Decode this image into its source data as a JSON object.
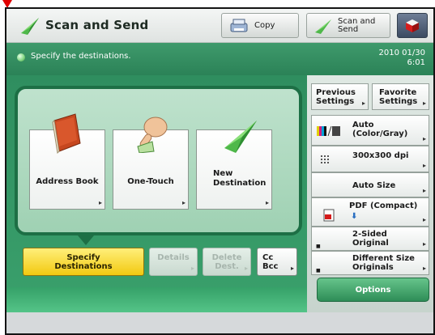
{
  "header": {
    "title": "Scan and Send",
    "copy_label": "Copy",
    "scan_send_label_1": "Scan and",
    "scan_send_label_2": "Send"
  },
  "status": {
    "message": "Specify the destinations.",
    "date": "2010 01/30",
    "time": "6:01"
  },
  "destinations": {
    "address_book": "Address Book",
    "one_touch": "One-Touch",
    "new_destination_1": "New",
    "new_destination_2": "Destination"
  },
  "actions": {
    "specify_1": "Specify",
    "specify_2": "Destinations",
    "details": "Details",
    "delete_1": "Delete",
    "delete_2": "Dest.",
    "cc": "Cc",
    "bcc": "Bcc"
  },
  "settings": {
    "previous_1": "Previous",
    "previous_2": "Settings",
    "favorite_1": "Favorite",
    "favorite_2": "Settings",
    "color_1": "Auto",
    "color_2": "(Color/Gray)",
    "resolution": "300x300 dpi",
    "size": "Auto Size",
    "format": "PDF (Compact)",
    "sided_1": "2-Sided",
    "sided_2": "Original",
    "diffsize_1": "Different Size",
    "diffsize_2": "Originals",
    "options": "Options"
  },
  "colors": {
    "accent_green": "#2b8257",
    "selected_yellow": "#f2c910",
    "marker_red": "#e10000"
  },
  "icons": {
    "app": "paper-plane-icon",
    "copy": "copier-icon",
    "scan_send": "paper-plane-icon",
    "settings": "cube-icon",
    "address_book": "book-icon",
    "one_touch": "finger-icon",
    "new_destination": "paper-plane-icon"
  }
}
